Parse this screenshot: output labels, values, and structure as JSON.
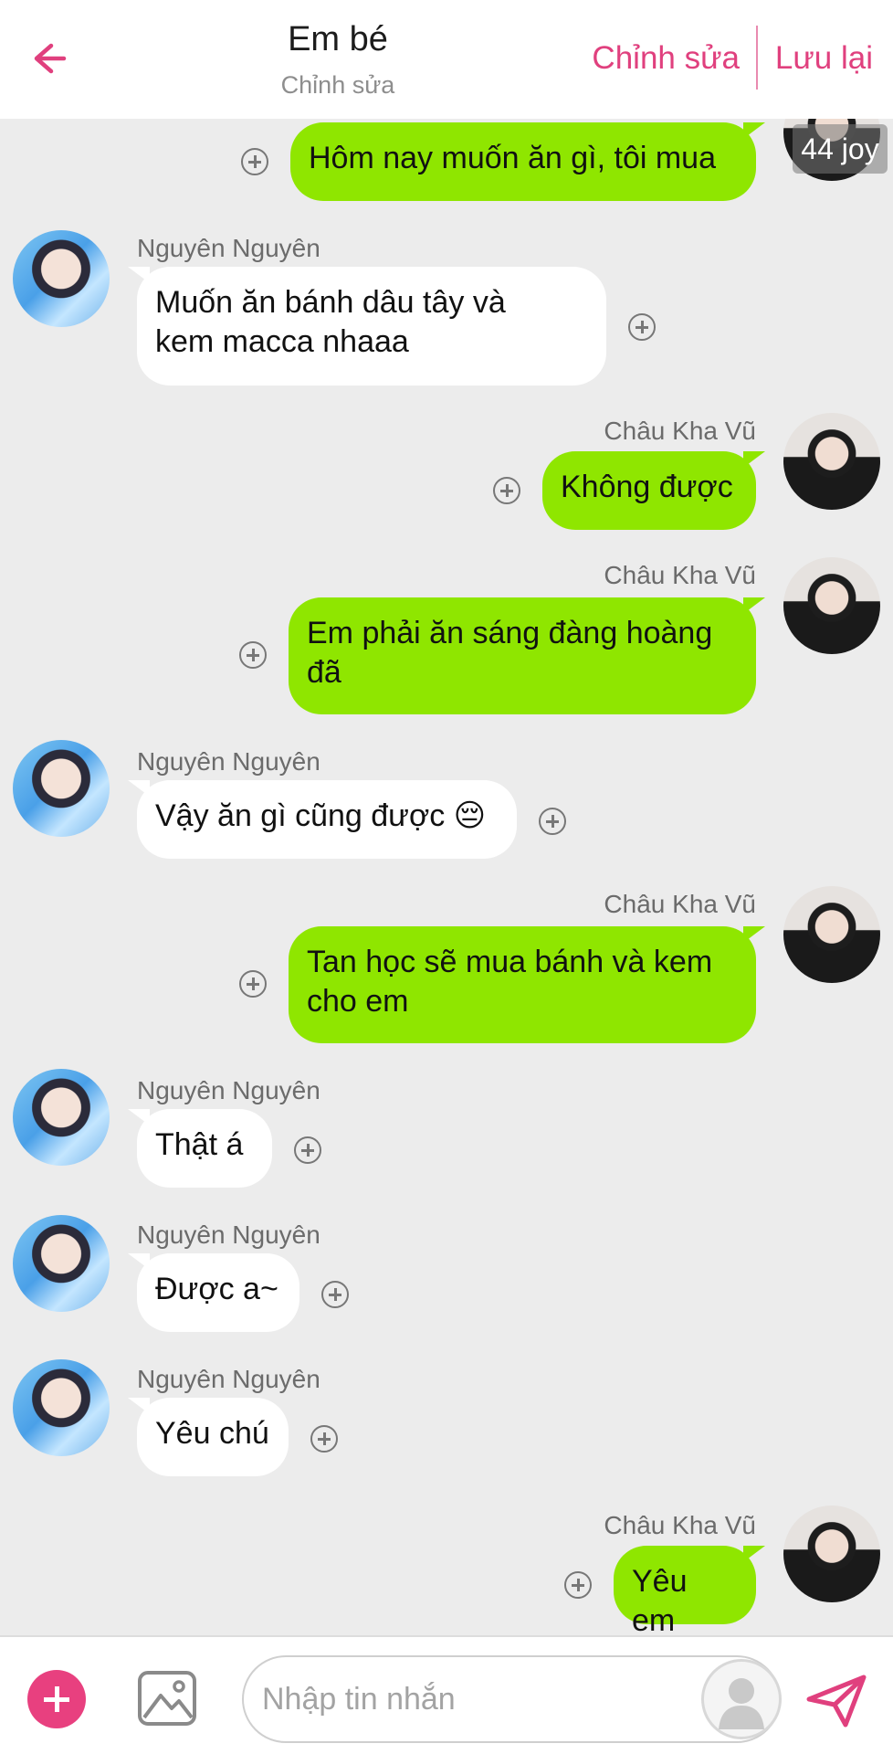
{
  "header": {
    "title": "Em bé",
    "subtitle": "Chỉnh sửa",
    "edit_label": "Chỉnh sửa",
    "save_label": "Lưu lại"
  },
  "top_badge": "44 joy",
  "messages": [
    {
      "side": "out",
      "sender": "",
      "text": "Hôm nay muốn ăn gì, tôi mua"
    },
    {
      "side": "in",
      "sender": "Nguyên Nguyên",
      "lines": [
        "Muốn ăn bánh dâu tây và",
        "kem macca nhaaa"
      ]
    },
    {
      "side": "out",
      "sender": "Châu Kha Vũ",
      "text": "Không được"
    },
    {
      "side": "out",
      "sender": "Châu Kha Vũ",
      "lines": [
        "Em phải ăn sáng đàng hoàng",
        "đã"
      ]
    },
    {
      "side": "in",
      "sender": "Nguyên Nguyên",
      "text": "Vậy ăn gì cũng được 😔"
    },
    {
      "side": "out",
      "sender": "Châu Kha Vũ",
      "lines": [
        "Tan học sẽ mua bánh và kem",
        "cho em"
      ]
    },
    {
      "side": "in",
      "sender": "Nguyên Nguyên",
      "text": "Thật á"
    },
    {
      "side": "in",
      "sender": "Nguyên Nguyên",
      "text": "Được a~"
    },
    {
      "side": "in",
      "sender": "Nguyên Nguyên",
      "text": "Yêu chú"
    },
    {
      "side": "out",
      "sender": "Châu Kha Vũ",
      "text": "Yêu em"
    }
  ],
  "composer": {
    "placeholder": "Nhập tin nhắn"
  },
  "icons": {
    "back": "arrow-left-icon",
    "add": "plus-circle-icon",
    "image": "image-icon",
    "send": "send-icon",
    "message_plus": "plus-circle-outline-icon"
  },
  "colors": {
    "accent": "#e8407f",
    "outgoing_bubble": "#8fe600",
    "incoming_bubble": "#ffffff",
    "background": "#ececec"
  }
}
